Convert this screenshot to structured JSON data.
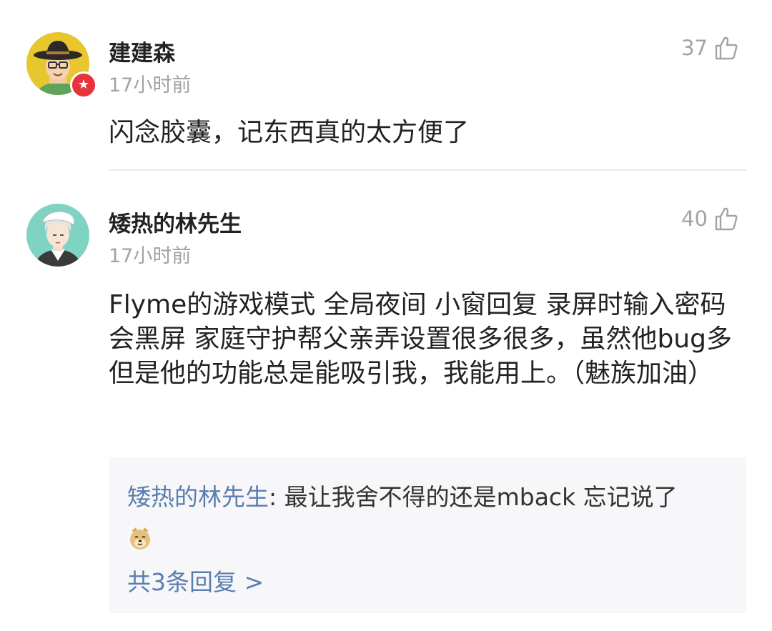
{
  "comments": [
    {
      "username": "建建森",
      "time": "17小时前",
      "likes": "37",
      "content": "闪念胶囊，记东西真的太方便了",
      "avatar_icon": "cowboy-avatar",
      "has_badge": true
    },
    {
      "username": "矮热的林先生",
      "time": "17小时前",
      "likes": "40",
      "content": "Flyme的游戏模式 全局夜间 小窗回复 录屏时输入密码会黑屏 家庭守护帮父亲弄设置很多很多，虽然他bug多但是他的功能总是能吸引我，我能用上。（魅族加油）",
      "avatar_icon": "anime-boy-avatar",
      "reply_preview": {
        "author": "矮热的林先生",
        "separator": ": ",
        "text": "最让我舍不得的还是mback 忘记说了",
        "emoji_icon": "doge-emoji"
      },
      "more_replies": "共3条回复 >"
    }
  ],
  "colors": {
    "link": "#5b7eb0",
    "muted": "#a3a3a3",
    "badge": "#e8323c",
    "reply_bg": "#f7f7f9"
  },
  "icons": {
    "like": "thumbs-up-icon",
    "badge": "star-badge-icon"
  }
}
